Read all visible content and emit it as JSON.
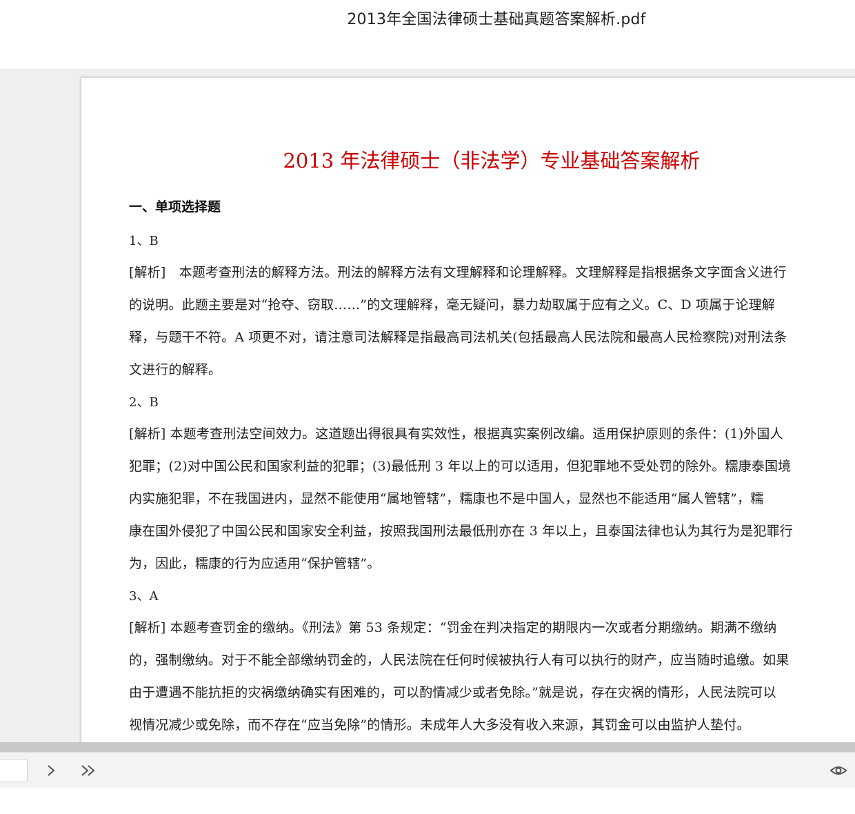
{
  "window": {
    "title": "2013年全国法律硕士基础真题答案解析.pdf"
  },
  "document": {
    "title": "2013 年法律硕士（非法学）专业基础答案解析",
    "section_heading": "一、单项选择题",
    "questions": [
      {
        "label": "1、B",
        "lines": [
          "[解析]　本题考查刑法的解释方法。刑法的解释方法有文理解释和论理解释。文理解释是指根据条文字面含义进行",
          "的说明。此题主要是对“抢夺、窃取……”的文理解释，毫无疑问，暴力劫取属于应有之义。C、D 项属于论理解",
          "释，与题干不符。A 项更不对，请注意司法解释是指最高司法机关(包括最高人民法院和最高人民检察院)对刑法条",
          "文进行的解释。"
        ]
      },
      {
        "label": "2、B",
        "lines": [
          "[解析] 本题考查刑法空间效力。这道题出得很具有实效性，根据真实案例改编。适用保护原则的条件：(1)外国人",
          "犯罪；(2)对中国公民和国家利益的犯罪；(3)最低刑 3 年以上的可以适用，但犯罪地不受处罚的除外。糯康泰国境",
          "内实施犯罪，不在我国进内，显然不能使用“属地管辖”，糯康也不是中国人，显然也不能适用“属人管辖”，糯",
          "康在国外侵犯了中国公民和国家安全利益，按照我国刑法最低刑亦在 3 年以上，且泰国法律也认为其行为是犯罪行",
          "为，因此，糯康的行为应适用“保护管辖”。"
        ]
      },
      {
        "label": "3、A",
        "lines": [
          "[解析] 本题考查罚金的缴纳。《刑法》第 53 条规定：“罚金在判决指定的期限内一次或者分期缴纳。期满不缴纳",
          "的，强制缴纳。对于不能全部缴纳罚金的，人民法院在任何时候被执行人有可以执行的财产，应当随时追缴。如果",
          "由于遭遇不能抗拒的灾祸缴纳确实有困难的，可以酌情减少或者免除。”就是说，存在灾祸的情形，人民法院可以",
          "视情况减少或免除，而不存在“应当免除”的情形。未成年人大多没有收入来源，其罚金可以由监护人垫付。"
        ]
      }
    ]
  },
  "toolbar": {
    "page_value": "",
    "icons": [
      "chevron-right-icon",
      "double-chevron-right-icon",
      "eye-icon"
    ]
  },
  "colors": {
    "title_red": "#cc0000",
    "viewer_bg": "#efefef",
    "text": "#222222"
  }
}
